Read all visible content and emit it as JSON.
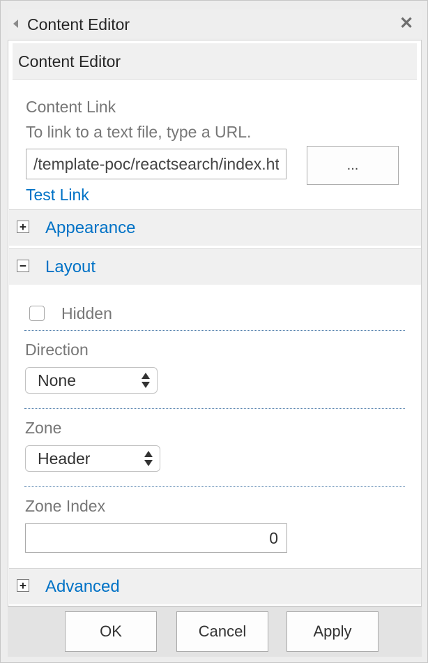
{
  "titlebar": {
    "title": "Content Editor"
  },
  "webpart": {
    "header": "Content Editor"
  },
  "content_link": {
    "label": "Content Link",
    "hint": "To link to a text file, type a URL.",
    "url_value": "/template-poc/reactsearch/index.html",
    "browse_label": "...",
    "test_link": "Test Link"
  },
  "sections": {
    "appearance": {
      "title": "Appearance",
      "toggle": "+",
      "expanded": false
    },
    "layout": {
      "title": "Layout",
      "toggle": "−",
      "expanded": true
    },
    "advanced": {
      "title": "Advanced",
      "toggle": "+",
      "expanded": false
    }
  },
  "layout": {
    "hidden_label": "Hidden",
    "hidden_checked": false,
    "direction_label": "Direction",
    "direction_value": "None",
    "zone_label": "Zone",
    "zone_value": "Header",
    "zone_index_label": "Zone Index",
    "zone_index_value": "0"
  },
  "footer": {
    "ok": "OK",
    "cancel": "Cancel",
    "apply": "Apply"
  },
  "icons": {
    "collapse": "collapse-left-triangle-icon",
    "close": "close-icon",
    "expand": "plus-box-icon",
    "collapse_section": "minus-box-icon",
    "select_arrows": "up-down-arrows-icon"
  },
  "colors": {
    "link": "#0072c6",
    "label": "#777777",
    "panel_bg": "#ededed"
  }
}
